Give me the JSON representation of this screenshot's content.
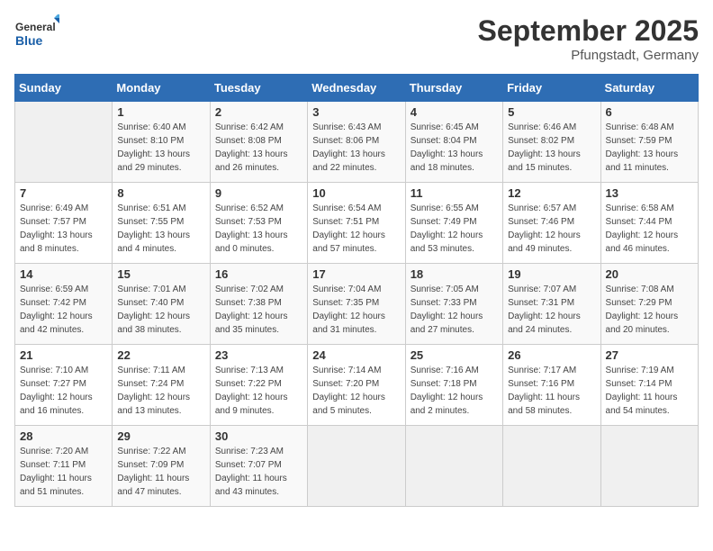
{
  "header": {
    "logo_general": "General",
    "logo_blue": "Blue",
    "month_title": "September 2025",
    "location": "Pfungstadt, Germany"
  },
  "days_of_week": [
    "Sunday",
    "Monday",
    "Tuesday",
    "Wednesday",
    "Thursday",
    "Friday",
    "Saturday"
  ],
  "weeks": [
    [
      {
        "day": "",
        "info": ""
      },
      {
        "day": "1",
        "info": "Sunrise: 6:40 AM\nSunset: 8:10 PM\nDaylight: 13 hours\nand 29 minutes."
      },
      {
        "day": "2",
        "info": "Sunrise: 6:42 AM\nSunset: 8:08 PM\nDaylight: 13 hours\nand 26 minutes."
      },
      {
        "day": "3",
        "info": "Sunrise: 6:43 AM\nSunset: 8:06 PM\nDaylight: 13 hours\nand 22 minutes."
      },
      {
        "day": "4",
        "info": "Sunrise: 6:45 AM\nSunset: 8:04 PM\nDaylight: 13 hours\nand 18 minutes."
      },
      {
        "day": "5",
        "info": "Sunrise: 6:46 AM\nSunset: 8:02 PM\nDaylight: 13 hours\nand 15 minutes."
      },
      {
        "day": "6",
        "info": "Sunrise: 6:48 AM\nSunset: 7:59 PM\nDaylight: 13 hours\nand 11 minutes."
      }
    ],
    [
      {
        "day": "7",
        "info": "Sunrise: 6:49 AM\nSunset: 7:57 PM\nDaylight: 13 hours\nand 8 minutes."
      },
      {
        "day": "8",
        "info": "Sunrise: 6:51 AM\nSunset: 7:55 PM\nDaylight: 13 hours\nand 4 minutes."
      },
      {
        "day": "9",
        "info": "Sunrise: 6:52 AM\nSunset: 7:53 PM\nDaylight: 13 hours\nand 0 minutes."
      },
      {
        "day": "10",
        "info": "Sunrise: 6:54 AM\nSunset: 7:51 PM\nDaylight: 12 hours\nand 57 minutes."
      },
      {
        "day": "11",
        "info": "Sunrise: 6:55 AM\nSunset: 7:49 PM\nDaylight: 12 hours\nand 53 minutes."
      },
      {
        "day": "12",
        "info": "Sunrise: 6:57 AM\nSunset: 7:46 PM\nDaylight: 12 hours\nand 49 minutes."
      },
      {
        "day": "13",
        "info": "Sunrise: 6:58 AM\nSunset: 7:44 PM\nDaylight: 12 hours\nand 46 minutes."
      }
    ],
    [
      {
        "day": "14",
        "info": "Sunrise: 6:59 AM\nSunset: 7:42 PM\nDaylight: 12 hours\nand 42 minutes."
      },
      {
        "day": "15",
        "info": "Sunrise: 7:01 AM\nSunset: 7:40 PM\nDaylight: 12 hours\nand 38 minutes."
      },
      {
        "day": "16",
        "info": "Sunrise: 7:02 AM\nSunset: 7:38 PM\nDaylight: 12 hours\nand 35 minutes."
      },
      {
        "day": "17",
        "info": "Sunrise: 7:04 AM\nSunset: 7:35 PM\nDaylight: 12 hours\nand 31 minutes."
      },
      {
        "day": "18",
        "info": "Sunrise: 7:05 AM\nSunset: 7:33 PM\nDaylight: 12 hours\nand 27 minutes."
      },
      {
        "day": "19",
        "info": "Sunrise: 7:07 AM\nSunset: 7:31 PM\nDaylight: 12 hours\nand 24 minutes."
      },
      {
        "day": "20",
        "info": "Sunrise: 7:08 AM\nSunset: 7:29 PM\nDaylight: 12 hours\nand 20 minutes."
      }
    ],
    [
      {
        "day": "21",
        "info": "Sunrise: 7:10 AM\nSunset: 7:27 PM\nDaylight: 12 hours\nand 16 minutes."
      },
      {
        "day": "22",
        "info": "Sunrise: 7:11 AM\nSunset: 7:24 PM\nDaylight: 12 hours\nand 13 minutes."
      },
      {
        "day": "23",
        "info": "Sunrise: 7:13 AM\nSunset: 7:22 PM\nDaylight: 12 hours\nand 9 minutes."
      },
      {
        "day": "24",
        "info": "Sunrise: 7:14 AM\nSunset: 7:20 PM\nDaylight: 12 hours\nand 5 minutes."
      },
      {
        "day": "25",
        "info": "Sunrise: 7:16 AM\nSunset: 7:18 PM\nDaylight: 12 hours\nand 2 minutes."
      },
      {
        "day": "26",
        "info": "Sunrise: 7:17 AM\nSunset: 7:16 PM\nDaylight: 11 hours\nand 58 minutes."
      },
      {
        "day": "27",
        "info": "Sunrise: 7:19 AM\nSunset: 7:14 PM\nDaylight: 11 hours\nand 54 minutes."
      }
    ],
    [
      {
        "day": "28",
        "info": "Sunrise: 7:20 AM\nSunset: 7:11 PM\nDaylight: 11 hours\nand 51 minutes."
      },
      {
        "day": "29",
        "info": "Sunrise: 7:22 AM\nSunset: 7:09 PM\nDaylight: 11 hours\nand 47 minutes."
      },
      {
        "day": "30",
        "info": "Sunrise: 7:23 AM\nSunset: 7:07 PM\nDaylight: 11 hours\nand 43 minutes."
      },
      {
        "day": "",
        "info": ""
      },
      {
        "day": "",
        "info": ""
      },
      {
        "day": "",
        "info": ""
      },
      {
        "day": "",
        "info": ""
      }
    ]
  ]
}
